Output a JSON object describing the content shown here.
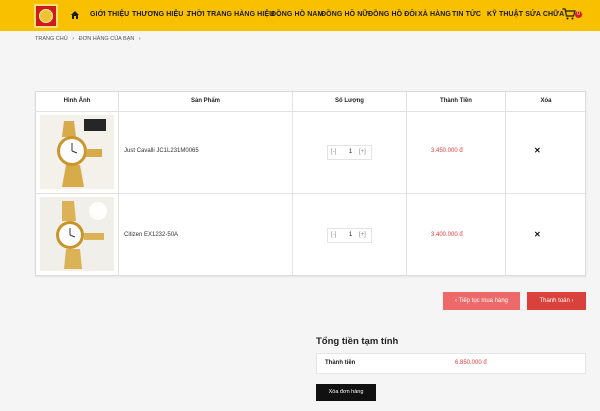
{
  "nav": {
    "logo_icon": "brand-logo",
    "home_icon": "home-icon",
    "items": [
      "GIỚI THIỆU",
      "THƯƠNG HIỆU",
      "THỜI TRANG HÀNG HIỆU",
      "ĐỒNG HỒ NAM",
      "ĐỒNG HỒ NỮ",
      "ĐỒNG HỒ ĐÔI",
      "XẢ HÀNG",
      "TIN TỨC",
      "KỸ THUẬT SỬA CHỮA"
    ],
    "caret": "⌄",
    "cart_icon": "cart-icon",
    "cart_count": "0"
  },
  "breadcrumb": {
    "home": "TRANG CHỦ",
    "sep": "›",
    "current": "ĐƠN HÀNG CỦA BẠN"
  },
  "table": {
    "headers": [
      "Hình Ảnh",
      "Sản Phẩm",
      "Số Lượng",
      "Thành Tiền",
      "Xóa"
    ],
    "rows": [
      {
        "name": "Just Cavalli JC1L231M0065",
        "qty": "1",
        "price": "3.450.000 đ",
        "minus": "[-]",
        "plus": "[+]",
        "remove": "✕"
      },
      {
        "name": "Citizen EX1232-50A",
        "qty": "1",
        "price": "3.400.000 đ",
        "minus": "[-]",
        "plus": "[+]",
        "remove": "✕"
      }
    ]
  },
  "actions": {
    "continue": "‹  Tiếp tục mua hàng",
    "checkout": "Thanh toán  ›"
  },
  "summary": {
    "title": "Tổng tiền tạm tính",
    "label": "Thành tiền",
    "value": "6.850.000 đ",
    "clear": "Xóa đơn hàng"
  },
  "colors": {
    "nav_bg": "#f9c000",
    "price": "#e33a3a",
    "continue_btn": "#ee6a6a",
    "checkout_btn": "#d9413c"
  }
}
